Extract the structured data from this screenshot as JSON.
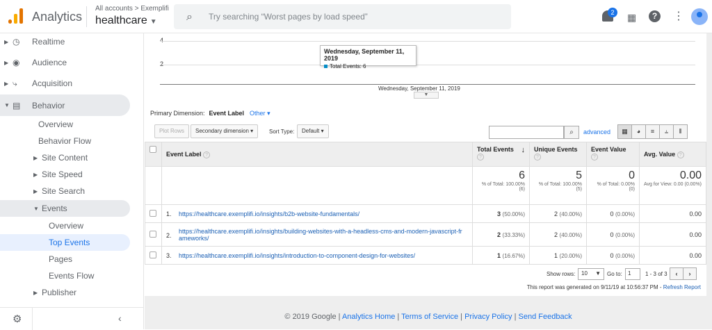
{
  "header": {
    "app_name": "Analytics",
    "account_path": "All accounts > Exemplifi",
    "property": "healthcare",
    "search_placeholder": "Try searching “Worst pages by load speed”",
    "notification_count": "2"
  },
  "sidebar": {
    "items": [
      {
        "label": "Realtime",
        "icon": "clock-icon"
      },
      {
        "label": "Audience",
        "icon": "person-icon"
      },
      {
        "label": "Acquisition",
        "icon": "acquisition-icon"
      },
      {
        "label": "Behavior",
        "icon": "behavior-icon"
      }
    ],
    "behavior_children": [
      "Overview",
      "Behavior Flow",
      "Site Content",
      "Site Speed",
      "Site Search",
      "Events"
    ],
    "events_children": [
      "Overview",
      "Top Events",
      "Pages",
      "Events Flow"
    ],
    "publisher": "Publisher"
  },
  "chart": {
    "y_ticks": [
      "4",
      "2"
    ],
    "tooltip_date": "Wednesday, September 11, 2019",
    "tooltip_metric": "Total Events: 6",
    "x_label": "Wednesday, September 11, 2019"
  },
  "chart_data": {
    "type": "line",
    "x": [
      "Wednesday, September 11, 2019"
    ],
    "series": [
      {
        "name": "Total Events",
        "values": [
          6
        ]
      }
    ],
    "yticks": [
      2,
      4
    ],
    "color": "#058dc7"
  },
  "dimension": {
    "label": "Primary Dimension:",
    "value": "Event Label",
    "other": "Other"
  },
  "toolbar": {
    "plot_rows": "Plot Rows",
    "secondary_dimension": "Secondary dimension",
    "sort_type_label": "Sort Type:",
    "sort_type_value": "Default",
    "advanced": "advanced"
  },
  "table": {
    "headers": [
      "Event Label",
      "Total Events",
      "Unique Events",
      "Event Value",
      "Avg. Value"
    ],
    "totals": {
      "total_events": "6",
      "total_events_sub": "% of Total: 100.00% (6)",
      "unique_events": "5",
      "unique_events_sub": "% of Total: 100.00% (5)",
      "event_value": "0",
      "event_value_sub": "% of Total: 0.00% (0)",
      "avg_value": "0.00",
      "avg_value_sub": "Avg for View: 0.00 (0.00%)"
    },
    "rows": [
      {
        "idx": "1.",
        "label": "https://healthcare.exemplifi.io/insights/b2b-website-fundamentals/",
        "total": "3",
        "total_pct": "(50.00%)",
        "unique": "2",
        "unique_pct": "(40.00%)",
        "value": "0",
        "value_pct": "(0.00%)",
        "avg": "0.00"
      },
      {
        "idx": "2.",
        "label": "https://healthcare.exemplifi.io/insights/building-websites-with-a-headless-cms-and-modern-javascript-frameworks/",
        "total": "2",
        "total_pct": "(33.33%)",
        "unique": "2",
        "unique_pct": "(40.00%)",
        "value": "0",
        "value_pct": "(0.00%)",
        "avg": "0.00"
      },
      {
        "idx": "3.",
        "label": "https://healthcare.exemplifi.io/insights/introduction-to-component-design-for-websites/",
        "total": "1",
        "total_pct": "(16.67%)",
        "unique": "1",
        "unique_pct": "(20.00%)",
        "value": "0",
        "value_pct": "(0.00%)",
        "avg": "0.00"
      }
    ]
  },
  "pagination": {
    "show_rows_label": "Show rows:",
    "show_rows_value": "10",
    "goto_label": "Go to:",
    "goto_value": "1",
    "range": "1 - 3 of 3"
  },
  "report_note": "This report was generated on 9/11/19 at 10:56:37 PM - ",
  "refresh_report": "Refresh Report",
  "footer": {
    "copyright": "© 2019 Google",
    "links": [
      "Analytics Home",
      "Terms of Service",
      "Privacy Policy",
      "Send Feedback"
    ]
  }
}
